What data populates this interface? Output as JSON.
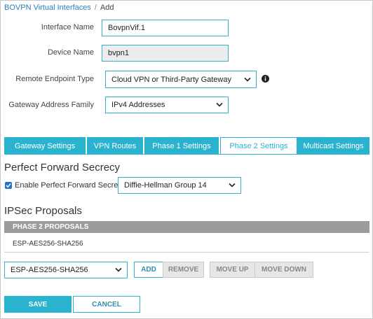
{
  "breadcrumb": {
    "parent": "BOVPN Virtual Interfaces",
    "separator": "/",
    "current": "Add"
  },
  "form": {
    "interface_name": {
      "label": "Interface Name",
      "value": "BovpnVif.1"
    },
    "device_name": {
      "label": "Device Name",
      "value": "bvpn1"
    },
    "remote_endpoint_type": {
      "label": "Remote Endpoint Type",
      "value": "Cloud VPN or Third-Party Gateway"
    },
    "gateway_address_family": {
      "label": "Gateway Address Family",
      "value": "IPv4 Addresses"
    }
  },
  "tabs": [
    {
      "label": "Gateway Settings"
    },
    {
      "label": "VPN Routes"
    },
    {
      "label": "Phase 1 Settings"
    },
    {
      "label": "Phase 2 Settings",
      "active": true
    },
    {
      "label": "Multicast Settings"
    }
  ],
  "pfs": {
    "title": "Perfect Forward Secrecy",
    "checkbox_label": "Enable Perfect Forward Secrecy",
    "checked": true,
    "group_value": "Diffie-Hellman Group 14"
  },
  "ipsec": {
    "title": "IPSec Proposals",
    "column_header": "PHASE 2 PROPOSALS",
    "rows": [
      "ESP-AES256-SHA256"
    ],
    "select_value": "ESP-AES256-SHA256",
    "add_label": "ADD",
    "remove_label": "REMOVE",
    "move_up_label": "MOVE UP",
    "move_down_label": "MOVE DOWN"
  },
  "footer": {
    "save_label": "SAVE",
    "cancel_label": "CANCEL"
  },
  "colors": {
    "accent": "#2ab3cf",
    "link": "#2a7fb8",
    "header_gray": "#9c9c9c"
  }
}
